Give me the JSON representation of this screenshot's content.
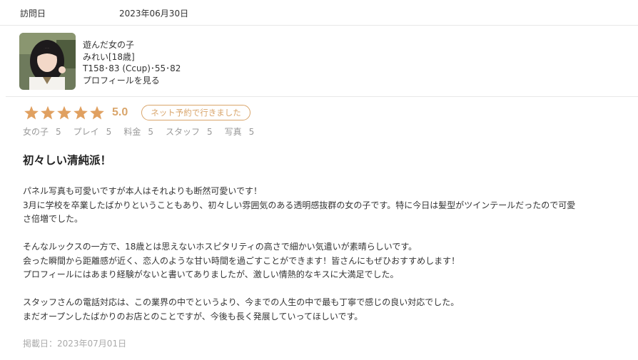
{
  "visit": {
    "label": "訪問日",
    "date": "2023年06月30日"
  },
  "girl": {
    "heading": "遊んだ女の子",
    "name": "みれい[18歳]",
    "stats": "T158･83 (Ccup)･55･82",
    "profile_link": "プロフィールを見る"
  },
  "rating": {
    "stars": 5,
    "score": "5.0",
    "badge": "ネット予約で行きました",
    "star_color": "#e0a060"
  },
  "subscores": [
    {
      "label": "女の子",
      "value": "5"
    },
    {
      "label": "プレイ",
      "value": "5"
    },
    {
      "label": "料金",
      "value": "5"
    },
    {
      "label": "スタッフ",
      "value": "5"
    },
    {
      "label": "写真",
      "value": "5"
    }
  ],
  "review": {
    "title": "初々しい清純派！",
    "paragraphs": [
      [
        "パネル写真も可愛いですが本人はそれよりも断然可愛いです！",
        "3月に学校を卒業したばかりということもあり、初々しい雰囲気のある透明感抜群の女の子です。特に今日は髪型がツインテールだったので可愛",
        "さ倍増でした。"
      ],
      [
        "そんなルックスの一方で、18歳とは思えないホスピタリティの高さで細かい気遣いが素晴らしいです。",
        "会った瞬間から距離感が近く、恋人のような甘い時間を過ごすことができます！皆さんにもぜひおすすめします！",
        "プロフィールにはあまり経験がないと書いてありましたが、激しい情熱的なキスに大満足でした。"
      ],
      [
        "スタッフさんの電話対応は、この業界の中でというより、今までの人生の中で最も丁寧で感じの良い対応でした。",
        "まだオープンしたばかりのお店とのことですが、今後も長く発展していってほしいです。"
      ]
    ],
    "posted": "掲載日：2023年07月01日"
  }
}
